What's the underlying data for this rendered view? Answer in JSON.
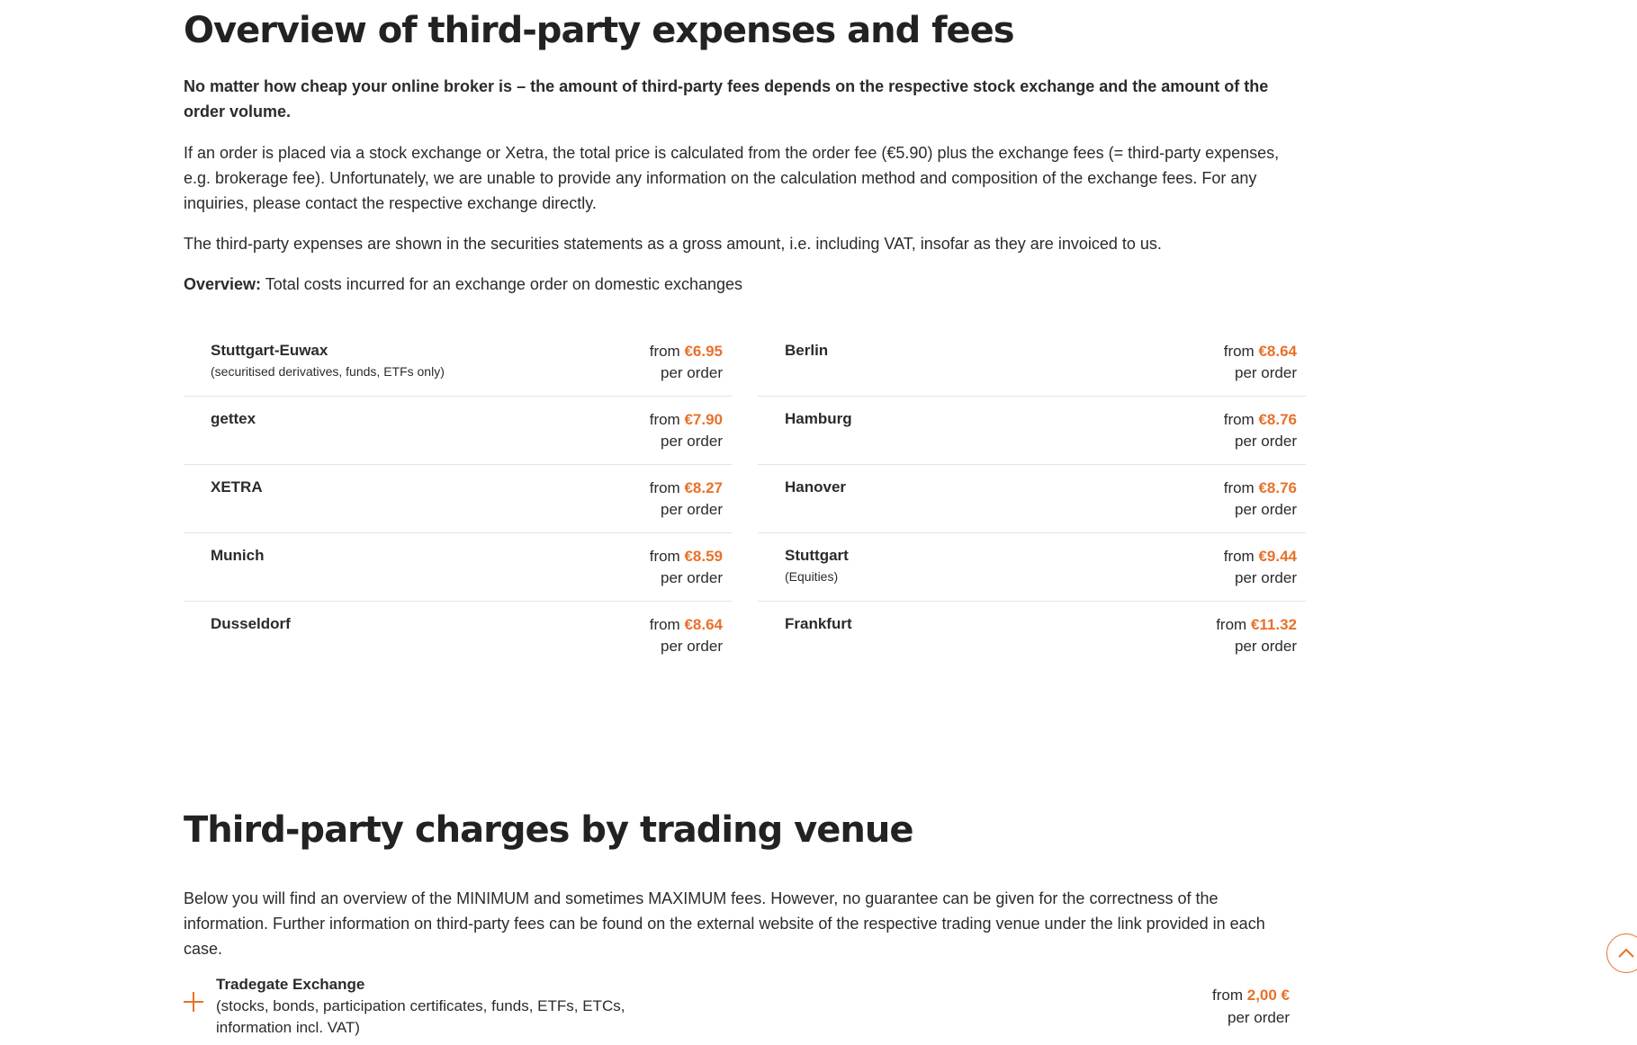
{
  "section1": {
    "title": "Overview of third-party expenses and fees",
    "lead": "No matter how cheap your online broker is – the amount of third-party fees depends on the respective stock exchange and the amount of the order volume.",
    "para1": "If an order is placed via a stock exchange or Xetra, the total price is calculated from the order fee (€5.90) plus the exchange fees (= third-party expenses, e.g. brokerage fee). Unfortunately, we are unable to provide any information on the calculation method and composition of the exchange fees. For any inquiries, please contact the respective exchange directly.",
    "para2": "The third-party expenses are shown in the securities statements as a gross amount, i.e. including VAT, insofar as they are invoiced to us.",
    "overview_label": "Overview:",
    "overview_text": " Total costs incurred for an exchange order on domestic exchanges"
  },
  "exchanges_left": [
    {
      "name": "Stuttgart-Euwax",
      "note": "(securitised derivatives, funds, ETFs only)",
      "from": "from ",
      "price": "€6.95",
      "per": "per order"
    },
    {
      "name": "gettex",
      "note": "",
      "from": "from ",
      "price": "€7.90",
      "per": "per order"
    },
    {
      "name": "XETRA",
      "note": "",
      "from": "from ",
      "price": "€8.27",
      "per": "per order"
    },
    {
      "name": "Munich",
      "note": "",
      "from": "from ",
      "price": "€8.59",
      "per": "per order"
    },
    {
      "name": "Dusseldorf",
      "note": "",
      "from": "from ",
      "price": "€8.64",
      "per": "per order"
    }
  ],
  "exchanges_right": [
    {
      "name": "Berlin",
      "note": "",
      "from": "from ",
      "price": "€8.64",
      "per": "per order"
    },
    {
      "name": "Hamburg",
      "note": "",
      "from": "from ",
      "price": "€8.76",
      "per": "per order"
    },
    {
      "name": "Hanover",
      "note": "",
      "from": "from ",
      "price": "€8.76",
      "per": "per order"
    },
    {
      "name": "Stuttgart",
      "note": "(Equities)",
      "from": "from ",
      "price": "€9.44",
      "per": "per order"
    },
    {
      "name": "Frankfurt",
      "note": "",
      "from": "from ",
      "price": "€11.32",
      "per": "per order"
    }
  ],
  "section2": {
    "title": "Third-party charges by trading venue",
    "intro": "Below you will find an overview of the MINIMUM and sometimes MAXIMUM fees. However, no guarantee can be given for the correctness of the information. Further information on third-party fees can be found on the external website of the respective trading venue under the link provided in each case.",
    "venue": {
      "name": "Tradegate Exchange",
      "note": "(stocks, bonds, participation certificates, funds, ETFs, ETCs, information incl. VAT)",
      "from": "from ",
      "price": "2,00 €",
      "per": "per order"
    }
  },
  "colors": {
    "accent": "#e8712a",
    "text": "#2b2b2b",
    "divider": "#e3e3e3"
  },
  "icons": {
    "expand": "plus-icon",
    "scroll_top": "chevron-up-icon"
  }
}
